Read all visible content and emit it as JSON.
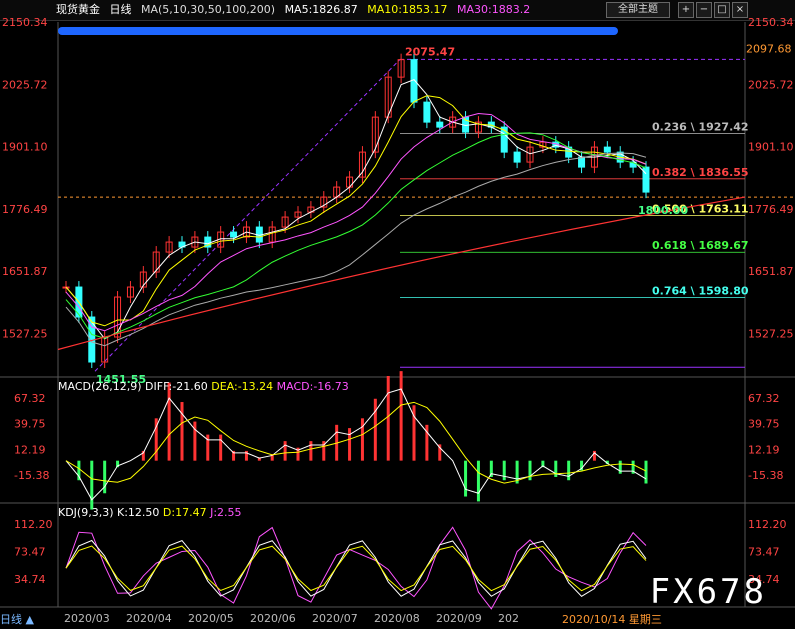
{
  "header": {
    "instrument": "现货黄金",
    "period": "日线",
    "ma_label": "MA(5,10,30,50,100,200)",
    "ma5": "MA5:1826.87",
    "ma10": "MA10:1853.17",
    "ma30": "MA30:1883.2",
    "theme_btn": "全部主题",
    "colors": {
      "ma5": "#ffffff",
      "ma10": "#ffff00",
      "ma30": "#ff55ff",
      "ma50": "#33ff33",
      "ma100": "#aaaaaa",
      "ma200": "#ff3333",
      "up": "#ff3333",
      "down": "#33ffff"
    }
  },
  "price_axis": {
    "labels": [
      "2150.34",
      "2025.72",
      "1901.10",
      "1776.49",
      "1651.87",
      "1527.25"
    ],
    "values": [
      2150.34,
      2025.72,
      1901.1,
      1776.49,
      1651.87,
      1527.25
    ],
    "top_right": "2097.68"
  },
  "annotations": {
    "high": "2075.47",
    "low": "1451.55",
    "last": "1800.00"
  },
  "fib": [
    {
      "label": "0.236 \\ 1927.42",
      "value": 1927.42,
      "color": "#bbbbbb"
    },
    {
      "label": "0.382 \\ 1836.55",
      "value": 1836.55,
      "color": "#ff4444"
    },
    {
      "label": "0.500 \\ 1763.11",
      "value": 1763.11,
      "color": "#ffff66"
    },
    {
      "label": "0.618 \\ 1689.67",
      "value": 1689.67,
      "color": "#44ff44"
    },
    {
      "label": "0.764 \\ 1598.80",
      "value": 1598.8,
      "color": "#44ffee"
    }
  ],
  "macd": {
    "label": "MACD(26,12,9)",
    "diff": "DIFF:-21.60",
    "dea": "DEA:-13.24",
    "macd": "MACD:-16.73",
    "axis": [
      "67.32",
      "39.75",
      "12.19",
      "-15.38"
    ],
    "values": [
      67.32,
      39.75,
      12.19,
      -15.38
    ]
  },
  "kdj": {
    "label": "KDJ(9,3,3)",
    "k": "K:12.50",
    "d": "D:17.47",
    "j": "J:2.55",
    "axis": [
      "112.20",
      "73.47",
      "34.74"
    ],
    "values": [
      112.2,
      73.47,
      34.74
    ]
  },
  "x_axis": [
    "2020/03",
    "2020/04",
    "2020/05",
    "2020/06",
    "2020/07",
    "2020/08",
    "2020/09",
    "202"
  ],
  "date_label": "2020/10/14 星期三",
  "period_tab": "日线 ▲",
  "watermark": "FX678",
  "chart_data": {
    "type": "candlestick",
    "title": "现货黄金 日线",
    "x": [
      "2020/03",
      "2020/04",
      "2020/05",
      "2020/06",
      "2020/07",
      "2020/08",
      "2020/09",
      "2020/10"
    ],
    "close": [
      1580,
      1700,
      1730,
      1760,
      1960,
      1970,
      1890,
      1895
    ],
    "ylim": [
      1440,
      2160
    ],
    "high": 2075.47,
    "low": 1451.55
  }
}
